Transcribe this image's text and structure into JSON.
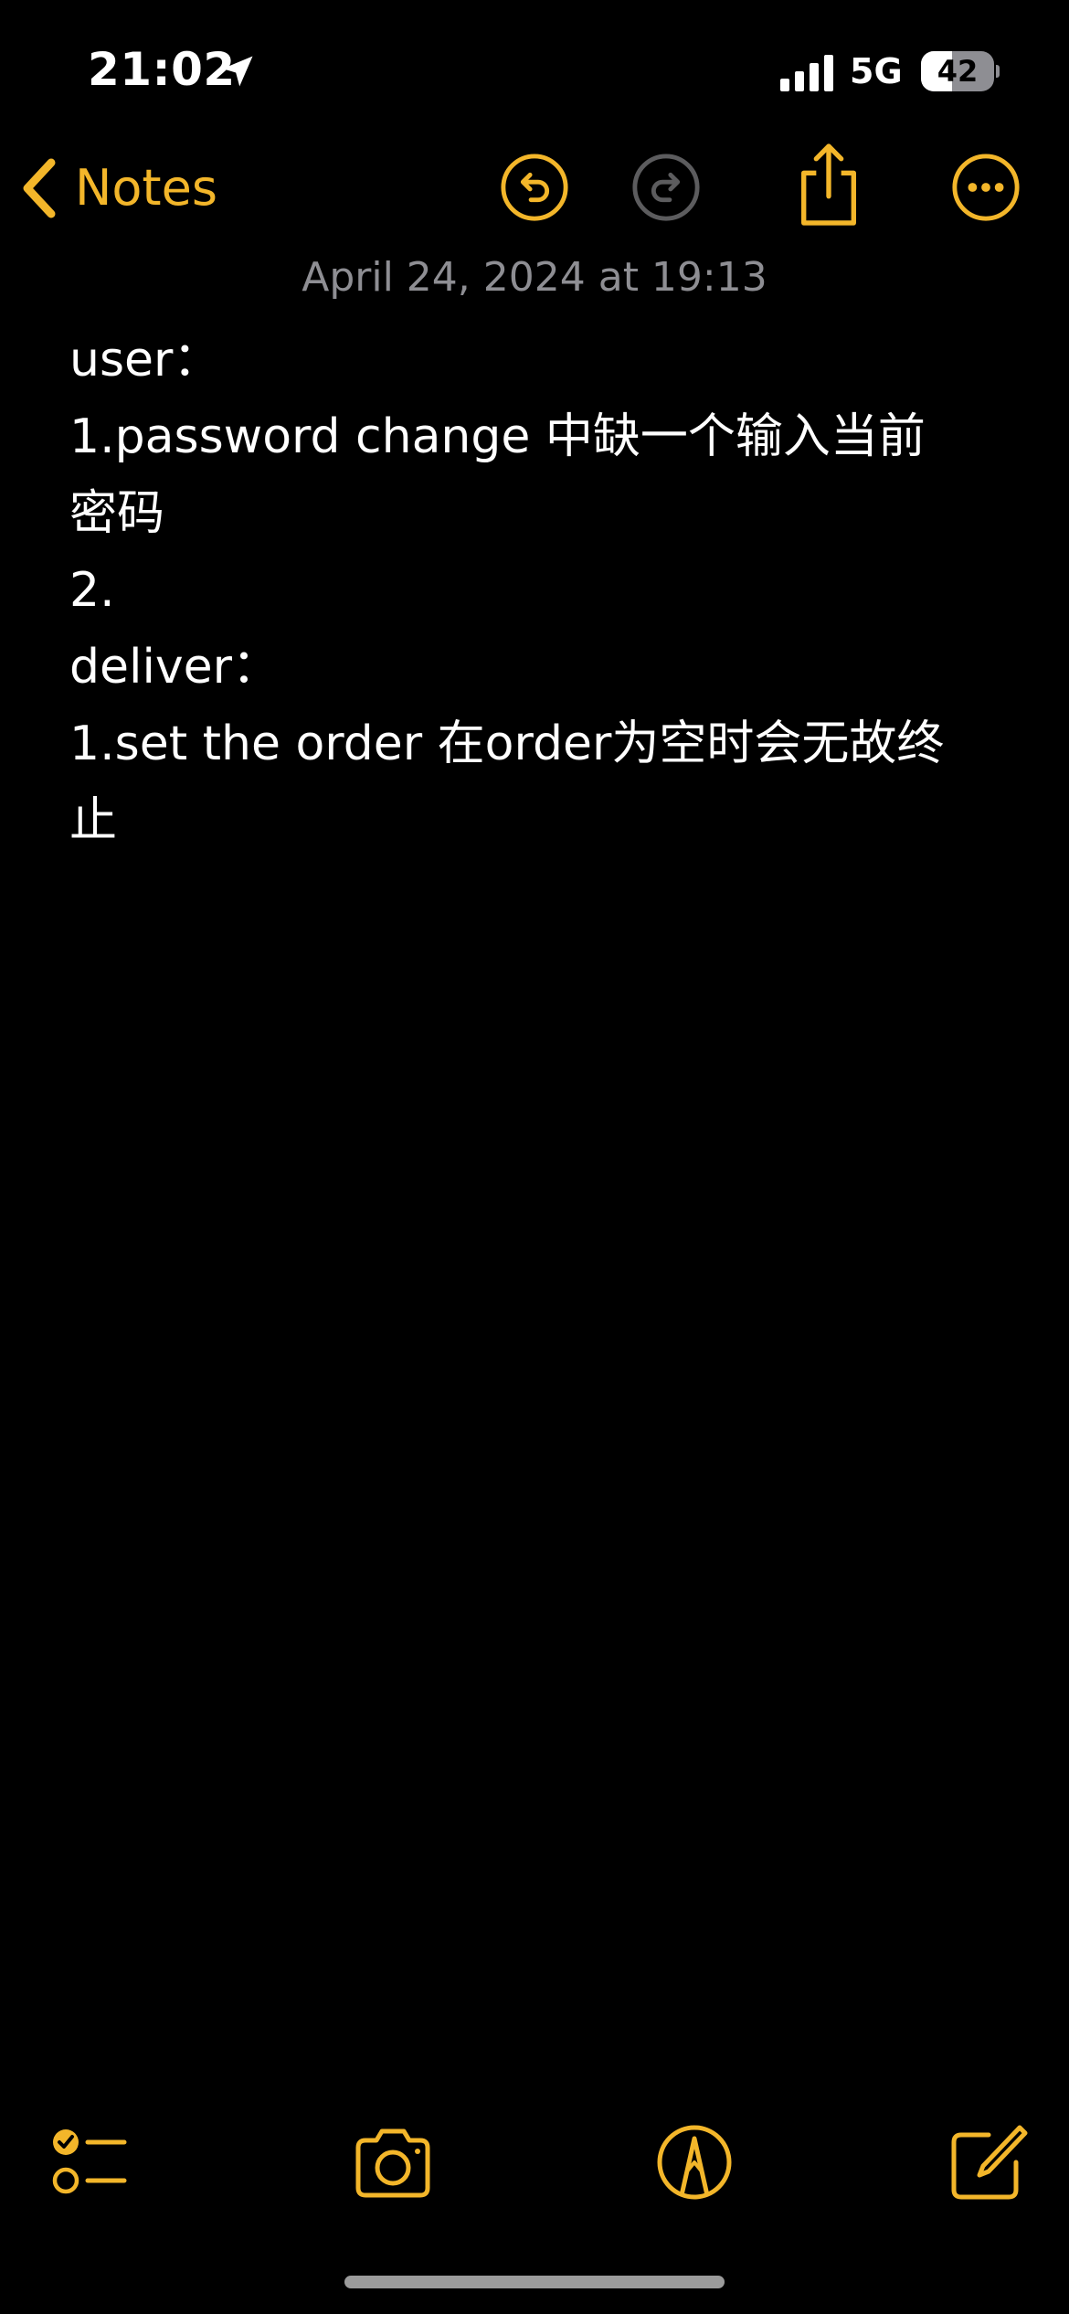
{
  "status_bar": {
    "time": "21:02",
    "carrier": "5G",
    "battery_percent": "42",
    "battery_level": 0.42
  },
  "nav": {
    "back_label": "Notes"
  },
  "note": {
    "date": "April 24, 2024 at 19:13",
    "lines": [
      "user：",
      "1.password change 中缺一个输入当前",
      "密码",
      "2.",
      "deliver：",
      "1.set the order 在order为空时会无故终",
      "止"
    ]
  },
  "colors": {
    "accent": "#f3b62a",
    "disabled": "#5c5c5e",
    "secondary_text": "#8e8e93",
    "background": "#000000"
  },
  "icons": {
    "back": "chevron-left-icon",
    "undo": "undo-icon",
    "redo": "redo-icon",
    "share": "share-icon",
    "more": "more-icon",
    "checklist": "checklist-icon",
    "camera": "camera-icon",
    "markup": "markup-icon",
    "compose": "compose-icon"
  }
}
